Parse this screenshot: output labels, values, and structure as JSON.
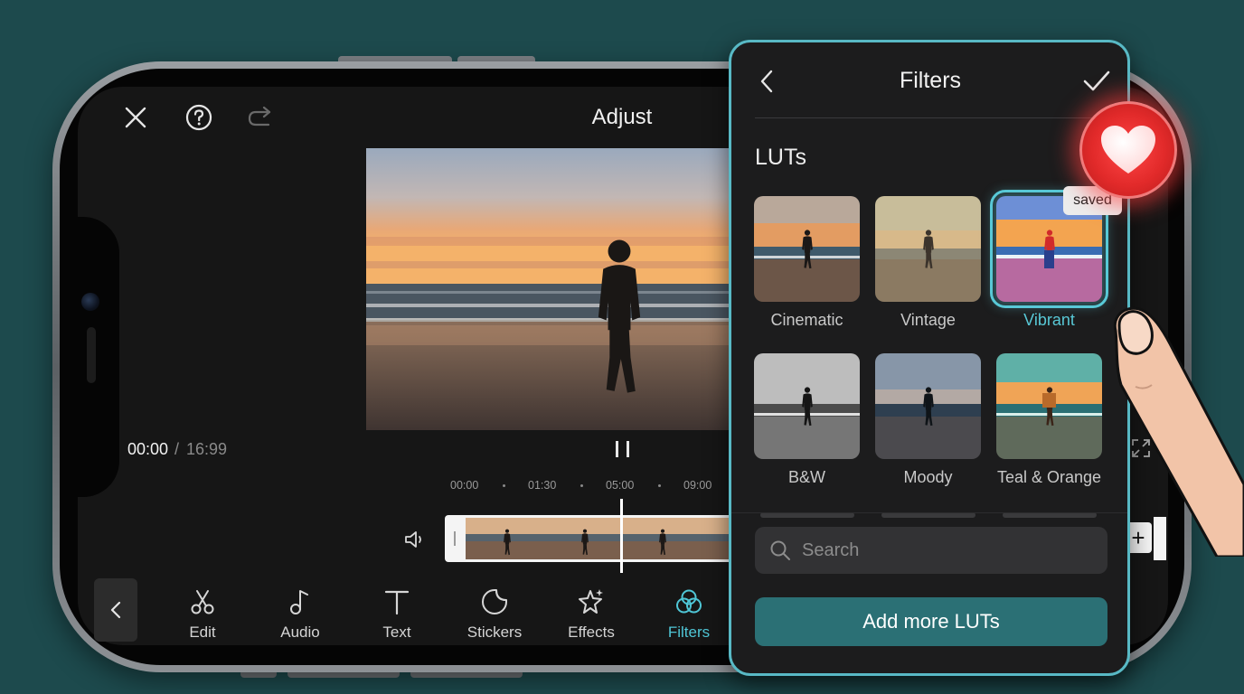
{
  "editor": {
    "title": "Adjust",
    "time_current": "00:00",
    "time_separator": "/",
    "time_total": "16:99"
  },
  "timeline": {
    "ruler_labels": [
      "00:00",
      "01:30",
      "05:00",
      "09:00"
    ],
    "add_clip_label": "+"
  },
  "toolbar": {
    "items": [
      {
        "label": "Edit",
        "icon": "scissors-icon"
      },
      {
        "label": "Audio",
        "icon": "music-note-icon"
      },
      {
        "label": "Text",
        "icon": "text-icon"
      },
      {
        "label": "Stickers",
        "icon": "sticker-icon"
      },
      {
        "label": "Effects",
        "icon": "sparkle-star-icon"
      },
      {
        "label": "Filters",
        "icon": "filters-circles-icon",
        "active": true
      }
    ]
  },
  "filters_panel": {
    "title": "Filters",
    "section_title": "LUTs",
    "luts": [
      {
        "label": "Cinematic"
      },
      {
        "label": "Vintage"
      },
      {
        "label": "Vibrant",
        "selected": true
      },
      {
        "label": "B&W"
      },
      {
        "label": "Moody"
      },
      {
        "label": "Teal & Orange"
      }
    ],
    "saved_badge": "saved",
    "search_placeholder": "Search",
    "add_button": "Add more LUTs"
  },
  "colors": {
    "accent": "#4fc6d6",
    "panel_border": "#58b9c5",
    "button": "#2b7075",
    "heart": "#e22a2a",
    "background": "#1d4a4d"
  }
}
